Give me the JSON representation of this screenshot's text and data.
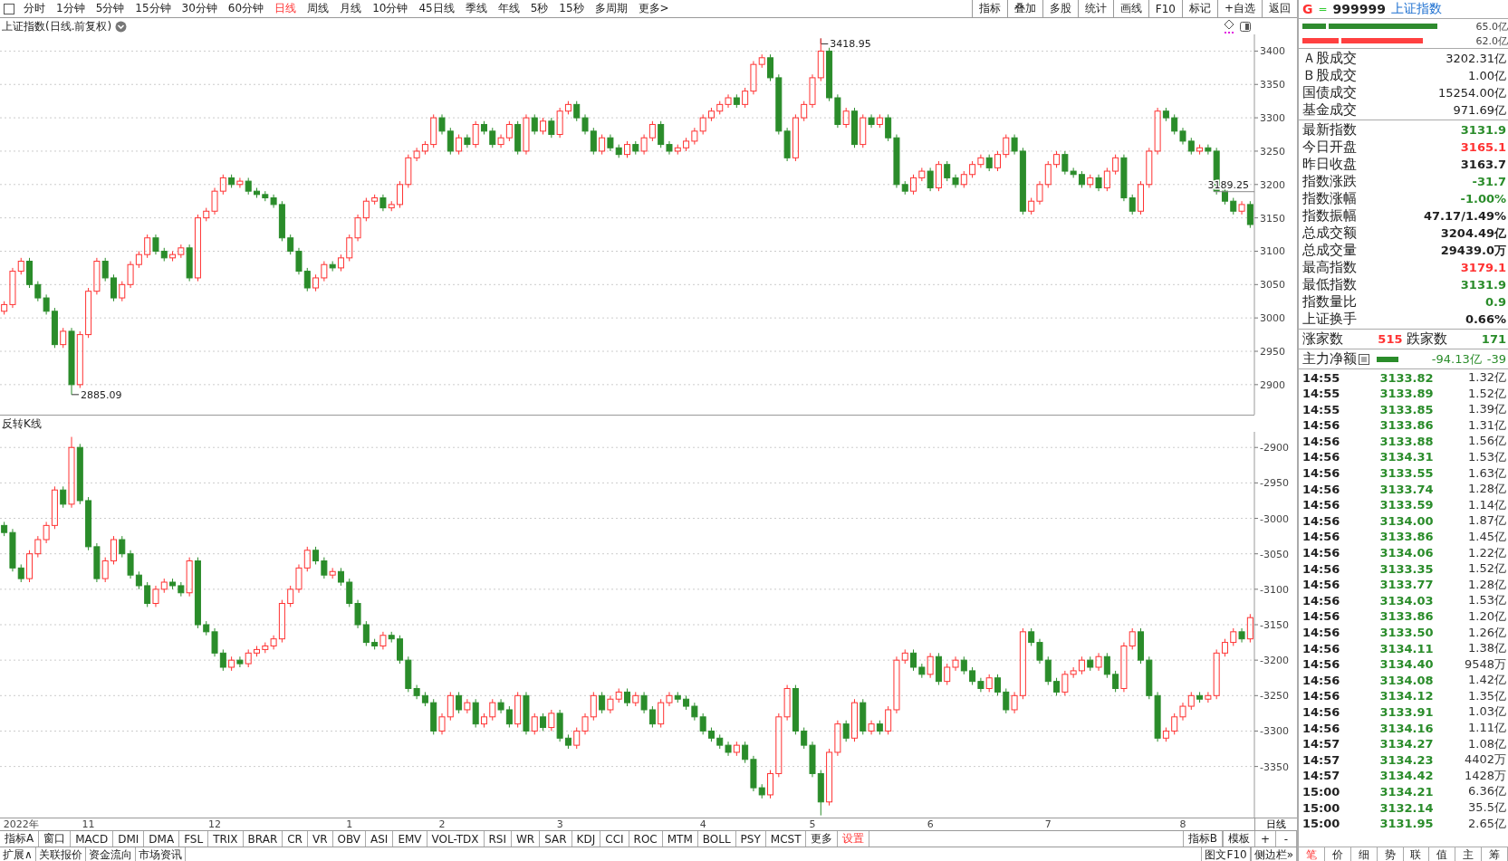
{
  "toolbar": {
    "periods": [
      {
        "label": "分时",
        "selected": false
      },
      {
        "label": "1分钟",
        "selected": false
      },
      {
        "label": "5分钟",
        "selected": false
      },
      {
        "label": "15分钟",
        "selected": false
      },
      {
        "label": "30分钟",
        "selected": false
      },
      {
        "label": "60分钟",
        "selected": false
      },
      {
        "label": "日线",
        "selected": true
      },
      {
        "label": "周线",
        "selected": false
      },
      {
        "label": "月线",
        "selected": false
      },
      {
        "label": "10分钟",
        "selected": false
      },
      {
        "label": "45日线",
        "selected": false
      },
      {
        "label": "季线",
        "selected": false
      },
      {
        "label": "年线",
        "selected": false
      },
      {
        "label": "5秒",
        "selected": false
      },
      {
        "label": "15秒",
        "selected": false
      },
      {
        "label": "多周期",
        "selected": false
      },
      {
        "label": "更多>",
        "selected": false
      }
    ],
    "actions": [
      "指标",
      "叠加",
      "多股",
      "统计",
      "画线",
      "F10",
      "标记",
      "+自选",
      "返回"
    ]
  },
  "main_chart": {
    "title": "上证指数(日线.前复权)",
    "chart_data": {
      "type": "candlestick",
      "grid": true,
      "ylim": [
        2855,
        3425
      ],
      "categories": [
        null,
        null,
        null,
        null,
        null,
        null,
        null,
        null,
        null,
        null,
        null,
        null,
        null,
        null,
        null,
        null,
        null,
        null,
        null,
        null,
        null,
        null,
        null,
        null,
        null,
        null,
        null,
        null,
        null,
        null,
        null,
        null,
        null,
        null,
        null,
        null,
        null,
        null,
        null,
        null,
        null,
        null,
        null,
        null,
        null,
        null,
        null,
        null,
        null,
        null,
        null,
        null,
        null,
        null,
        null,
        null,
        null,
        null,
        null,
        null,
        null,
        null,
        null,
        null,
        null,
        null,
        null,
        null,
        null,
        null,
        null,
        null,
        null,
        null,
        null,
        null,
        null,
        null,
        null,
        null,
        null,
        null,
        null,
        null,
        null,
        null,
        null,
        null,
        null,
        null,
        null,
        null,
        null,
        null,
        null,
        null,
        null,
        null,
        null,
        null,
        null,
        null,
        null,
        null,
        null,
        null,
        null,
        null,
        null,
        null,
        null,
        null,
        null,
        null,
        null,
        null,
        null,
        null,
        null,
        null,
        null,
        null,
        null,
        null,
        null,
        null,
        null,
        null,
        null,
        null,
        null,
        null,
        null,
        null,
        null,
        null,
        null,
        null,
        null,
        null,
        null,
        null,
        null,
        null,
        null,
        null,
        null,
        null,
        null
      ],
      "yticks": [
        2900,
        2950,
        3000,
        3050,
        3100,
        3150,
        3200,
        3250,
        3300,
        3350,
        3400
      ],
      "ohlc": [
        [
          3010,
          3025,
          3005,
          3020
        ],
        [
          3020,
          3075,
          3015,
          3070
        ],
        [
          3070,
          3090,
          3065,
          3085
        ],
        [
          3085,
          3090,
          3045,
          3050
        ],
        [
          3050,
          3055,
          3025,
          3030
        ],
        [
          3030,
          3035,
          3005,
          3010
        ],
        [
          3010,
          3015,
          2955,
          2960
        ],
        [
          2960,
          2985,
          2955,
          2980
        ],
        [
          2980,
          2985,
          2885.09,
          2900
        ],
        [
          2900,
          2980,
          2895,
          2975
        ],
        [
          2975,
          3045,
          2970,
          3040
        ],
        [
          3040,
          3090,
          3035,
          3085
        ],
        [
          3085,
          3090,
          3055,
          3060
        ],
        [
          3060,
          3065,
          3025,
          3030
        ],
        [
          3030,
          3055,
          3025,
          3050
        ],
        [
          3050,
          3085,
          3045,
          3080
        ],
        [
          3080,
          3100,
          3075,
          3095
        ],
        [
          3095,
          3125,
          3090,
          3120
        ],
        [
          3120,
          3125,
          3095,
          3100
        ],
        [
          3100,
          3105,
          3085,
          3090
        ],
        [
          3090,
          3100,
          3085,
          3095
        ],
        [
          3095,
          3110,
          3090,
          3105
        ],
        [
          3105,
          3110,
          3055,
          3060
        ],
        [
          3060,
          3155,
          3055,
          3150
        ],
        [
          3150,
          3165,
          3145,
          3160
        ],
        [
          3160,
          3195,
          3155,
          3190
        ],
        [
          3190,
          3215,
          3185,
          3210
        ],
        [
          3210,
          3215,
          3195,
          3200
        ],
        [
          3200,
          3210,
          3195,
          3205
        ],
        [
          3205,
          3210,
          3185,
          3190
        ],
        [
          3190,
          3195,
          3180,
          3185
        ],
        [
          3185,
          3190,
          3175,
          3180
        ],
        [
          3180,
          3185,
          3165,
          3170
        ],
        [
          3170,
          3175,
          3115,
          3120
        ],
        [
          3120,
          3125,
          3095,
          3100
        ],
        [
          3100,
          3105,
          3065,
          3070
        ],
        [
          3070,
          3075,
          3040,
          3045
        ],
        [
          3045,
          3065,
          3040,
          3060
        ],
        [
          3060,
          3085,
          3055,
          3080
        ],
        [
          3080,
          3085,
          3070,
          3075
        ],
        [
          3075,
          3095,
          3070,
          3090
        ],
        [
          3090,
          3125,
          3085,
          3120
        ],
        [
          3120,
          3155,
          3115,
          3150
        ],
        [
          3150,
          3180,
          3145,
          3175
        ],
        [
          3175,
          3185,
          3170,
          3180
        ],
        [
          3180,
          3185,
          3160,
          3165
        ],
        [
          3165,
          3175,
          3160,
          3170
        ],
        [
          3170,
          3205,
          3165,
          3200
        ],
        [
          3200,
          3245,
          3195,
          3240
        ],
        [
          3240,
          3255,
          3235,
          3250
        ],
        [
          3250,
          3265,
          3245,
          3260
        ],
        [
          3260,
          3305,
          3255,
          3300
        ],
        [
          3300,
          3305,
          3275,
          3280
        ],
        [
          3280,
          3285,
          3245,
          3250
        ],
        [
          3250,
          3275,
          3245,
          3270
        ],
        [
          3270,
          3275,
          3255,
          3260
        ],
        [
          3260,
          3295,
          3255,
          3290
        ],
        [
          3290,
          3295,
          3275,
          3280
        ],
        [
          3280,
          3285,
          3255,
          3260
        ],
        [
          3260,
          3275,
          3255,
          3270
        ],
        [
          3270,
          3295,
          3265,
          3290
        ],
        [
          3290,
          3295,
          3245,
          3250
        ],
        [
          3250,
          3305,
          3245,
          3300
        ],
        [
          3300,
          3305,
          3275,
          3280
        ],
        [
          3280,
          3300,
          3275,
          3295
        ],
        [
          3295,
          3300,
          3270,
          3275
        ],
        [
          3275,
          3315,
          3270,
          3310
        ],
        [
          3310,
          3325,
          3305,
          3320
        ],
        [
          3320,
          3325,
          3295,
          3300
        ],
        [
          3300,
          3305,
          3275,
          3280
        ],
        [
          3280,
          3285,
          3245,
          3250
        ],
        [
          3250,
          3275,
          3245,
          3270
        ],
        [
          3270,
          3275,
          3250,
          3255
        ],
        [
          3255,
          3260,
          3240,
          3245
        ],
        [
          3245,
          3265,
          3240,
          3260
        ],
        [
          3260,
          3265,
          3245,
          3250
        ],
        [
          3250,
          3275,
          3245,
          3270
        ],
        [
          3270,
          3295,
          3265,
          3290
        ],
        [
          3290,
          3295,
          3255,
          3260
        ],
        [
          3260,
          3265,
          3245,
          3250
        ],
        [
          3250,
          3260,
          3245,
          3255
        ],
        [
          3255,
          3270,
          3250,
          3265
        ],
        [
          3265,
          3285,
          3260,
          3280
        ],
        [
          3280,
          3305,
          3275,
          3300
        ],
        [
          3300,
          3315,
          3295,
          3310
        ],
        [
          3310,
          3325,
          3305,
          3320
        ],
        [
          3320,
          3335,
          3315,
          3330
        ],
        [
          3330,
          3335,
          3315,
          3320
        ],
        [
          3320,
          3345,
          3315,
          3340
        ],
        [
          3340,
          3385,
          3335,
          3380
        ],
        [
          3380,
          3395,
          3375,
          3390
        ],
        [
          3390,
          3395,
          3355,
          3360
        ],
        [
          3360,
          3365,
          3275,
          3280
        ],
        [
          3280,
          3285,
          3235,
          3240
        ],
        [
          3240,
          3305,
          3235,
          3300
        ],
        [
          3300,
          3325,
          3295,
          3320
        ],
        [
          3320,
          3365,
          3315,
          3360
        ],
        [
          3360,
          3418.95,
          3355,
          3400
        ],
        [
          3400,
          3405,
          3325,
          3330
        ],
        [
          3330,
          3335,
          3285,
          3290
        ],
        [
          3290,
          3315,
          3285,
          3310
        ],
        [
          3310,
          3315,
          3255,
          3260
        ],
        [
          3260,
          3305,
          3255,
          3300
        ],
        [
          3300,
          3305,
          3285,
          3290
        ],
        [
          3290,
          3305,
          3285,
          3300
        ],
        [
          3300,
          3305,
          3265,
          3270
        ],
        [
          3270,
          3275,
          3195,
          3200
        ],
        [
          3200,
          3205,
          3185,
          3190
        ],
        [
          3190,
          3215,
          3185,
          3210
        ],
        [
          3210,
          3225,
          3205,
          3220
        ],
        [
          3220,
          3225,
          3190,
          3195
        ],
        [
          3195,
          3235,
          3190,
          3230
        ],
        [
          3230,
          3235,
          3205,
          3210
        ],
        [
          3210,
          3215,
          3195,
          3200
        ],
        [
          3200,
          3220,
          3195,
          3215
        ],
        [
          3215,
          3235,
          3210,
          3230
        ],
        [
          3230,
          3245,
          3225,
          3240
        ],
        [
          3240,
          3245,
          3220,
          3225
        ],
        [
          3225,
          3250,
          3220,
          3245
        ],
        [
          3245,
          3275,
          3240,
          3270
        ],
        [
          3270,
          3275,
          3245,
          3250
        ],
        [
          3250,
          3255,
          3155,
          3160
        ],
        [
          3160,
          3180,
          3155,
          3175
        ],
        [
          3175,
          3205,
          3170,
          3200
        ],
        [
          3200,
          3235,
          3195,
          3230
        ],
        [
          3230,
          3250,
          3225,
          3245
        ],
        [
          3245,
          3250,
          3215,
          3220
        ],
        [
          3220,
          3225,
          3210,
          3215
        ],
        [
          3215,
          3220,
          3195,
          3200
        ],
        [
          3200,
          3215,
          3195,
          3210
        ],
        [
          3210,
          3215,
          3190,
          3195
        ],
        [
          3195,
          3225,
          3190,
          3220
        ],
        [
          3220,
          3245,
          3215,
          3240
        ],
        [
          3240,
          3245,
          3175,
          3180
        ],
        [
          3180,
          3185,
          3155,
          3160
        ],
        [
          3160,
          3205,
          3155,
          3200
        ],
        [
          3200,
          3255,
          3195,
          3250
        ],
        [
          3250,
          3315,
          3245,
          3310
        ],
        [
          3310,
          3315,
          3295,
          3300
        ],
        [
          3300,
          3305,
          3275,
          3280
        ],
        [
          3280,
          3285,
          3260,
          3265
        ],
        [
          3265,
          3270,
          3245,
          3250
        ],
        [
          3250,
          3260,
          3245,
          3255
        ],
        [
          3255,
          3260,
          3245,
          3250
        ],
        [
          3250,
          3255,
          3185,
          3190
        ],
        [
          3190,
          3195,
          3170,
          3175
        ],
        [
          3175,
          3180,
          3155,
          3160
        ],
        [
          3160,
          3175,
          3155,
          3170
        ],
        [
          3170,
          3175,
          3135,
          3140
        ]
      ],
      "annotations": [
        {
          "text": "3418.95"
        },
        {
          "text": "2885.09"
        },
        {
          "text": "3189.25"
        }
      ]
    }
  },
  "reverse_chart": {
    "title": "反转K线",
    "chart_data": {
      "type": "candlestick",
      "grid": true,
      "ylim": [
        -3422,
        -2878
      ],
      "yticks": [
        -3350,
        -3300,
        -3250,
        -3200,
        -3150,
        -3100,
        -3050,
        -3000,
        -2950,
        -2900
      ],
      "categories": [
        null,
        null,
        "2022年",
        null,
        null,
        null,
        null,
        null,
        null,
        null,
        "11",
        null,
        null,
        null,
        null,
        null,
        null,
        null,
        null,
        null,
        null,
        null,
        null,
        null,
        null,
        "12",
        null,
        null,
        null,
        null,
        null,
        null,
        null,
        null,
        null,
        null,
        null,
        null,
        null,
        null,
        null,
        "1",
        null,
        null,
        null,
        null,
        null,
        null,
        null,
        null,
        null,
        null,
        "2",
        null,
        null,
        null,
        null,
        null,
        null,
        null,
        null,
        null,
        null,
        null,
        null,
        null,
        "3",
        null,
        null,
        null,
        null,
        null,
        null,
        null,
        null,
        null,
        null,
        null,
        null,
        null,
        null,
        null,
        null,
        "4",
        null,
        null,
        null,
        null,
        null,
        null,
        null,
        null,
        null,
        null,
        null,
        null,
        "5",
        null,
        null,
        null,
        null,
        null,
        null,
        null,
        null,
        null,
        null,
        null,
        null,
        null,
        "6",
        null,
        null,
        null,
        null,
        null,
        null,
        null,
        null,
        null,
        null,
        null,
        null,
        null,
        "7",
        null,
        null,
        null,
        null,
        null,
        null,
        null,
        null,
        null,
        null,
        null,
        null,
        null,
        null,
        null,
        "8",
        null,
        null,
        null,
        null,
        null,
        null,
        null,
        null
      ],
      "ohlc": [
        [
          -3010,
          -3005,
          -3025,
          -3020
        ],
        [
          -3020,
          -3015,
          -3075,
          -3070
        ],
        [
          -3070,
          -3065,
          -3090,
          -3085
        ],
        [
          -3085,
          -3045,
          -3090,
          -3050
        ],
        [
          -3050,
          -3025,
          -3055,
          -3030
        ],
        [
          -3030,
          -3005,
          -3035,
          -3010
        ],
        [
          -3010,
          -2955,
          -3015,
          -2960
        ],
        [
          -2960,
          -2955,
          -2985,
          -2980
        ],
        [
          -2980,
          -2885.09,
          -2985,
          -2900
        ],
        [
          -2900,
          -2895,
          -2980,
          -2975
        ],
        [
          -2975,
          -2970,
          -3045,
          -3040
        ],
        [
          -3040,
          -3035,
          -3090,
          -3085
        ],
        [
          -3085,
          -3055,
          -3090,
          -3060
        ],
        [
          -3060,
          -3025,
          -3065,
          -3030
        ],
        [
          -3030,
          -3025,
          -3055,
          -3050
        ],
        [
          -3050,
          -3045,
          -3085,
          -3080
        ],
        [
          -3080,
          -3075,
          -3100,
          -3095
        ],
        [
          -3095,
          -3090,
          -3125,
          -3120
        ],
        [
          -3120,
          -3095,
          -3125,
          -3100
        ],
        [
          -3100,
          -3085,
          -3105,
          -3090
        ],
        [
          -3090,
          -3085,
          -3100,
          -3095
        ],
        [
          -3095,
          -3090,
          -3110,
          -3105
        ],
        [
          -3105,
          -3055,
          -3110,
          -3060
        ],
        [
          -3060,
          -3055,
          -3155,
          -3150
        ],
        [
          -3150,
          -3145,
          -3165,
          -3160
        ],
        [
          -3160,
          -3155,
          -3195,
          -3190
        ],
        [
          -3190,
          -3185,
          -3215,
          -3210
        ],
        [
          -3210,
          -3195,
          -3215,
          -3200
        ],
        [
          -3200,
          -3195,
          -3210,
          -3205
        ],
        [
          -3205,
          -3185,
          -3210,
          -3190
        ],
        [
          -3190,
          -3180,
          -3195,
          -3185
        ],
        [
          -3185,
          -3175,
          -3190,
          -3180
        ],
        [
          -3180,
          -3165,
          -3185,
          -3170
        ],
        [
          -3170,
          -3115,
          -3175,
          -3120
        ],
        [
          -3120,
          -3095,
          -3125,
          -3100
        ],
        [
          -3100,
          -3065,
          -3105,
          -3070
        ],
        [
          -3070,
          -3040,
          -3075,
          -3045
        ],
        [
          -3045,
          -3040,
          -3065,
          -3060
        ],
        [
          -3060,
          -3055,
          -3085,
          -3080
        ],
        [
          -3080,
          -3070,
          -3085,
          -3075
        ],
        [
          -3075,
          -3070,
          -3095,
          -3090
        ],
        [
          -3090,
          -3085,
          -3125,
          -3120
        ],
        [
          -3120,
          -3115,
          -3155,
          -3150
        ],
        [
          -3150,
          -3145,
          -3180,
          -3175
        ],
        [
          -3175,
          -3170,
          -3185,
          -3180
        ],
        [
          -3180,
          -3160,
          -3185,
          -3165
        ],
        [
          -3165,
          -3160,
          -3175,
          -3170
        ],
        [
          -3170,
          -3165,
          -3205,
          -3200
        ],
        [
          -3200,
          -3195,
          -3245,
          -3240
        ],
        [
          -3240,
          -3235,
          -3255,
          -3250
        ],
        [
          -3250,
          -3245,
          -3265,
          -3260
        ],
        [
          -3260,
          -3255,
          -3305,
          -3300
        ],
        [
          -3300,
          -3275,
          -3305,
          -3280
        ],
        [
          -3280,
          -3245,
          -3285,
          -3250
        ],
        [
          -3250,
          -3245,
          -3275,
          -3270
        ],
        [
          -3270,
          -3255,
          -3275,
          -3260
        ],
        [
          -3260,
          -3255,
          -3295,
          -3290
        ],
        [
          -3290,
          -3275,
          -3295,
          -3280
        ],
        [
          -3280,
          -3255,
          -3285,
          -3260
        ],
        [
          -3260,
          -3255,
          -3275,
          -3270
        ],
        [
          -3270,
          -3265,
          -3295,
          -3290
        ],
        [
          -3290,
          -3245,
          -3295,
          -3250
        ],
        [
          -3250,
          -3245,
          -3305,
          -3300
        ],
        [
          -3300,
          -3275,
          -3305,
          -3280
        ],
        [
          -3280,
          -3275,
          -3300,
          -3295
        ],
        [
          -3295,
          -3270,
          -3300,
          -3275
        ],
        [
          -3275,
          -3270,
          -3315,
          -3310
        ],
        [
          -3310,
          -3305,
          -3325,
          -3320
        ],
        [
          -3320,
          -3295,
          -3325,
          -3300
        ],
        [
          -3300,
          -3275,
          -3305,
          -3280
        ],
        [
          -3280,
          -3245,
          -3285,
          -3250
        ],
        [
          -3250,
          -3245,
          -3275,
          -3270
        ],
        [
          -3270,
          -3250,
          -3275,
          -3255
        ],
        [
          -3255,
          -3240,
          -3260,
          -3245
        ],
        [
          -3245,
          -3240,
          -3265,
          -3260
        ],
        [
          -3260,
          -3245,
          -3265,
          -3250
        ],
        [
          -3250,
          -3245,
          -3275,
          -3270
        ],
        [
          -3270,
          -3265,
          -3295,
          -3290
        ],
        [
          -3290,
          -3255,
          -3295,
          -3260
        ],
        [
          -3260,
          -3245,
          -3265,
          -3250
        ],
        [
          -3250,
          -3245,
          -3260,
          -3255
        ],
        [
          -3255,
          -3250,
          -3270,
          -3265
        ],
        [
          -3265,
          -3260,
          -3285,
          -3280
        ],
        [
          -3280,
          -3275,
          -3305,
          -3300
        ],
        [
          -3300,
          -3295,
          -3315,
          -3310
        ],
        [
          -3310,
          -3305,
          -3325,
          -3320
        ],
        [
          -3320,
          -3315,
          -3335,
          -3330
        ],
        [
          -3330,
          -3315,
          -3335,
          -3320
        ],
        [
          -3320,
          -3315,
          -3345,
          -3340
        ],
        [
          -3340,
          -3335,
          -3385,
          -3380
        ],
        [
          -3380,
          -3375,
          -3395,
          -3390
        ],
        [
          -3390,
          -3355,
          -3395,
          -3360
        ],
        [
          -3360,
          -3275,
          -3365,
          -3280
        ],
        [
          -3280,
          -3235,
          -3285,
          -3240
        ],
        [
          -3240,
          -3235,
          -3305,
          -3300
        ],
        [
          -3300,
          -3295,
          -3325,
          -3320
        ],
        [
          -3320,
          -3315,
          -3365,
          -3360
        ],
        [
          -3360,
          -3355,
          -3418.95,
          -3400
        ],
        [
          -3400,
          -3325,
          -3405,
          -3330
        ],
        [
          -3330,
          -3285,
          -3335,
          -3290
        ],
        [
          -3290,
          -3285,
          -3315,
          -3310
        ],
        [
          -3310,
          -3255,
          -3315,
          -3260
        ],
        [
          -3260,
          -3255,
          -3305,
          -3300
        ],
        [
          -3300,
          -3285,
          -3305,
          -3290
        ],
        [
          -3290,
          -3285,
          -3305,
          -3300
        ],
        [
          -3300,
          -3265,
          -3305,
          -3270
        ],
        [
          -3270,
          -3195,
          -3275,
          -3200
        ],
        [
          -3200,
          -3185,
          -3205,
          -3190
        ],
        [
          -3190,
          -3185,
          -3215,
          -3210
        ],
        [
          -3210,
          -3205,
          -3225,
          -3220
        ],
        [
          -3220,
          -3190,
          -3225,
          -3195
        ],
        [
          -3195,
          -3190,
          -3235,
          -3230
        ],
        [
          -3230,
          -3205,
          -3235,
          -3210
        ],
        [
          -3210,
          -3195,
          -3215,
          -3200
        ],
        [
          -3200,
          -3195,
          -3220,
          -3215
        ],
        [
          -3215,
          -3210,
          -3235,
          -3230
        ],
        [
          -3230,
          -3225,
          -3245,
          -3240
        ],
        [
          -3240,
          -3220,
          -3245,
          -3225
        ],
        [
          -3225,
          -3220,
          -3250,
          -3245
        ],
        [
          -3245,
          -3240,
          -3275,
          -3270
        ],
        [
          -3270,
          -3245,
          -3275,
          -3250
        ],
        [
          -3250,
          -3155,
          -3255,
          -3160
        ],
        [
          -3160,
          -3155,
          -3180,
          -3175
        ],
        [
          -3175,
          -3170,
          -3205,
          -3200
        ],
        [
          -3200,
          -3195,
          -3235,
          -3230
        ],
        [
          -3230,
          -3225,
          -3250,
          -3245
        ],
        [
          -3245,
          -3215,
          -3250,
          -3220
        ],
        [
          -3220,
          -3210,
          -3225,
          -3215
        ],
        [
          -3215,
          -3195,
          -3220,
          -3200
        ],
        [
          -3200,
          -3195,
          -3215,
          -3210
        ],
        [
          -3210,
          -3190,
          -3215,
          -3195
        ],
        [
          -3195,
          -3190,
          -3225,
          -3220
        ],
        [
          -3220,
          -3215,
          -3245,
          -3240
        ],
        [
          -3240,
          -3175,
          -3245,
          -3180
        ],
        [
          -3180,
          -3155,
          -3185,
          -3160
        ],
        [
          -3160,
          -3155,
          -3205,
          -3200
        ],
        [
          -3200,
          -3195,
          -3255,
          -3250
        ],
        [
          -3250,
          -3245,
          -3315,
          -3310
        ],
        [
          -3310,
          -3295,
          -3315,
          -3300
        ],
        [
          -3300,
          -3275,
          -3305,
          -3280
        ],
        [
          -3280,
          -3260,
          -3285,
          -3265
        ],
        [
          -3265,
          -3245,
          -3270,
          -3250
        ],
        [
          -3250,
          -3245,
          -3260,
          -3255
        ],
        [
          -3255,
          -3245,
          -3260,
          -3250
        ],
        [
          -3250,
          -3185,
          -3255,
          -3190
        ],
        [
          -3190,
          -3170,
          -3195,
          -3175
        ],
        [
          -3175,
          -3155,
          -3180,
          -3160
        ],
        [
          -3160,
          -3155,
          -3175,
          -3170
        ],
        [
          -3170,
          -3135,
          -3175,
          -3140
        ]
      ]
    }
  },
  "x_axis": {
    "period_label": "日线"
  },
  "indicator_bar": {
    "tabs": [
      {
        "label": "指标A",
        "kind": "indicator"
      },
      {
        "label": "窗口",
        "kind": "indicator"
      },
      {
        "label": "MACD",
        "kind": "indicator"
      },
      {
        "label": "DMI",
        "kind": "indicator"
      },
      {
        "label": "DMA",
        "kind": "indicator"
      },
      {
        "label": "FSL",
        "kind": "indicator"
      },
      {
        "label": "TRIX",
        "kind": "indicator"
      },
      {
        "label": "BRAR",
        "kind": "indicator"
      },
      {
        "label": "CR",
        "kind": "indicator"
      },
      {
        "label": "VR",
        "kind": "indicator"
      },
      {
        "label": "OBV",
        "kind": "indicator"
      },
      {
        "label": "ASI",
        "kind": "indicator"
      },
      {
        "label": "EMV",
        "kind": "indicator"
      },
      {
        "label": "VOL-TDX",
        "kind": "indicator"
      },
      {
        "label": "RSI",
        "kind": "indicator"
      },
      {
        "label": "WR",
        "kind": "indicator"
      },
      {
        "label": "SAR",
        "kind": "indicator"
      },
      {
        "label": "KDJ",
        "kind": "indicator"
      },
      {
        "label": "CCI",
        "kind": "indicator"
      },
      {
        "label": "ROC",
        "kind": "indicator"
      },
      {
        "label": "MTM",
        "kind": "indicator"
      },
      {
        "label": "BOLL",
        "kind": "indicator"
      },
      {
        "label": "PSY",
        "kind": "indicator"
      },
      {
        "label": "MCST",
        "kind": "indicator"
      },
      {
        "label": "更多",
        "kind": "indicator"
      },
      {
        "label": "设置",
        "kind": "settings"
      }
    ],
    "right": [
      "指标B",
      "模板"
    ],
    "zoom": [
      "+",
      "-"
    ]
  },
  "bottom_tabs": {
    "left": [
      "扩展∧",
      "关联报价",
      "资金流向",
      "市场资讯"
    ],
    "right": [
      "图文F10",
      "侧边栏»"
    ]
  },
  "quote_panel": {
    "header": {
      "letter": "G",
      "mark": "=",
      "code": "999999",
      "name": "上证指数"
    },
    "volume_bars": [
      {
        "color": "#2e8b2e",
        "value": "65.0亿"
      },
      {
        "color": "#ff4040",
        "value": "62.0亿"
      }
    ],
    "turnover": [
      {
        "label": "Ａ股成交",
        "value": "3202.31亿"
      },
      {
        "label": "Ｂ股成交",
        "value": "1.00亿"
      },
      {
        "label": "国债成交",
        "value": "15254.00亿"
      },
      {
        "label": "基金成交",
        "value": "971.69亿"
      }
    ],
    "stats": [
      {
        "label": "最新指数",
        "value": "3131.9",
        "color": "#2a8c2a"
      },
      {
        "label": "今日开盘",
        "value": "3165.1",
        "color": "#ff3232"
      },
      {
        "label": "昨日收盘",
        "value": "3163.7",
        "color": "#222222"
      },
      {
        "label": "指数涨跌",
        "value": "-31.7",
        "color": "#2a8c2a"
      },
      {
        "label": "指数涨幅",
        "value": "-1.00%",
        "color": "#2a8c2a"
      },
      {
        "label": "指数振幅",
        "value": "47.17/1.49%",
        "color": "#222222"
      },
      {
        "label": "总成交额",
        "value": "3204.49亿",
        "color": "#222222"
      },
      {
        "label": "总成交量",
        "value": "29439.0万",
        "color": "#222222"
      },
      {
        "label": "最高指数",
        "value": "3179.1",
        "color": "#ff3232"
      },
      {
        "label": "最低指数",
        "value": "3131.9",
        "color": "#2a8c2a"
      },
      {
        "label": "指数量比",
        "value": "0.9",
        "color": "#2a8c2a"
      },
      {
        "label": "上证换手",
        "value": "0.66%",
        "color": "#222222"
      }
    ],
    "breadth": {
      "up_label": "涨家数",
      "up_count": "515",
      "down_label": "跌家数",
      "down_count": "171"
    },
    "main_flow": {
      "label": "主力净额",
      "value": "-94.13亿",
      "extra": "-39"
    },
    "ticks": [
      {
        "time": "14:55",
        "price": "3133.82",
        "volume": "1.32亿"
      },
      {
        "time": "14:55",
        "price": "3133.89",
        "volume": "1.52亿"
      },
      {
        "time": "14:55",
        "price": "3133.85",
        "volume": "1.39亿"
      },
      {
        "time": "14:56",
        "price": "3133.86",
        "volume": "1.31亿"
      },
      {
        "time": "14:56",
        "price": "3133.88",
        "volume": "1.56亿"
      },
      {
        "time": "14:56",
        "price": "3134.31",
        "volume": "1.53亿"
      },
      {
        "time": "14:56",
        "price": "3133.55",
        "volume": "1.63亿"
      },
      {
        "time": "14:56",
        "price": "3133.74",
        "volume": "1.28亿"
      },
      {
        "time": "14:56",
        "price": "3133.59",
        "volume": "1.14亿"
      },
      {
        "time": "14:56",
        "price": "3134.00",
        "volume": "1.87亿"
      },
      {
        "time": "14:56",
        "price": "3133.86",
        "volume": "1.45亿"
      },
      {
        "time": "14:56",
        "price": "3134.06",
        "volume": "1.22亿"
      },
      {
        "time": "14:56",
        "price": "3133.35",
        "volume": "1.52亿"
      },
      {
        "time": "14:56",
        "price": "3133.77",
        "volume": "1.28亿"
      },
      {
        "time": "14:56",
        "price": "3134.03",
        "volume": "1.53亿"
      },
      {
        "time": "14:56",
        "price": "3133.86",
        "volume": "1.20亿"
      },
      {
        "time": "14:56",
        "price": "3133.50",
        "volume": "1.26亿"
      },
      {
        "time": "14:56",
        "price": "3134.11",
        "volume": "1.38亿"
      },
      {
        "time": "14:56",
        "price": "3134.40",
        "volume": "9548万"
      },
      {
        "time": "14:56",
        "price": "3134.08",
        "volume": "1.42亿"
      },
      {
        "time": "14:56",
        "price": "3134.12",
        "volume": "1.35亿"
      },
      {
        "time": "14:56",
        "price": "3133.91",
        "volume": "1.03亿"
      },
      {
        "time": "14:56",
        "price": "3134.16",
        "volume": "1.11亿"
      },
      {
        "time": "14:57",
        "price": "3134.27",
        "volume": "1.08亿"
      },
      {
        "time": "14:57",
        "price": "3134.23",
        "volume": "4402万"
      },
      {
        "time": "14:57",
        "price": "3134.42",
        "volume": "1428万"
      },
      {
        "time": "15:00",
        "price": "3134.21",
        "volume": "6.36亿"
      },
      {
        "time": "15:00",
        "price": "3132.14",
        "volume": "35.5亿"
      },
      {
        "time": "15:00",
        "price": "3131.95",
        "volume": "2.65亿"
      }
    ],
    "tabs": [
      {
        "label": "笔",
        "selected": true
      },
      {
        "label": "价",
        "selected": false
      },
      {
        "label": "细",
        "selected": false
      },
      {
        "label": "势",
        "selected": false
      },
      {
        "label": "联",
        "selected": false
      },
      {
        "label": "值",
        "selected": false
      },
      {
        "label": "主",
        "selected": false
      },
      {
        "label": "筹",
        "selected": false
      }
    ]
  }
}
